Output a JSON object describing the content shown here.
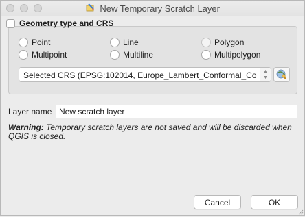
{
  "window": {
    "title": "New Temporary Scratch Layer",
    "title_icon": "scratch-layer-icon"
  },
  "geometry_group": {
    "title": "Geometry type and CRS",
    "checked": false,
    "options": [
      {
        "label": "Point",
        "selected": false
      },
      {
        "label": "Line",
        "selected": false
      },
      {
        "label": "Polygon",
        "selected": false
      },
      {
        "label": "Multipoint",
        "selected": false
      },
      {
        "label": "Multiline",
        "selected": false
      },
      {
        "label": "Multipolygon",
        "selected": false
      }
    ],
    "crs_selected": "Selected CRS (EPSG:102014, Europe_Lambert_Conformal_Co",
    "crs_button_icon": "crs-selector-icon"
  },
  "layer": {
    "label": "Layer name",
    "value": "New scratch layer"
  },
  "warning": {
    "prefix": "Warning:",
    "text": " Temporary scratch layers are not saved and will be discarded when QGIS is closed."
  },
  "buttons": {
    "cancel": "Cancel",
    "ok": "OK"
  }
}
